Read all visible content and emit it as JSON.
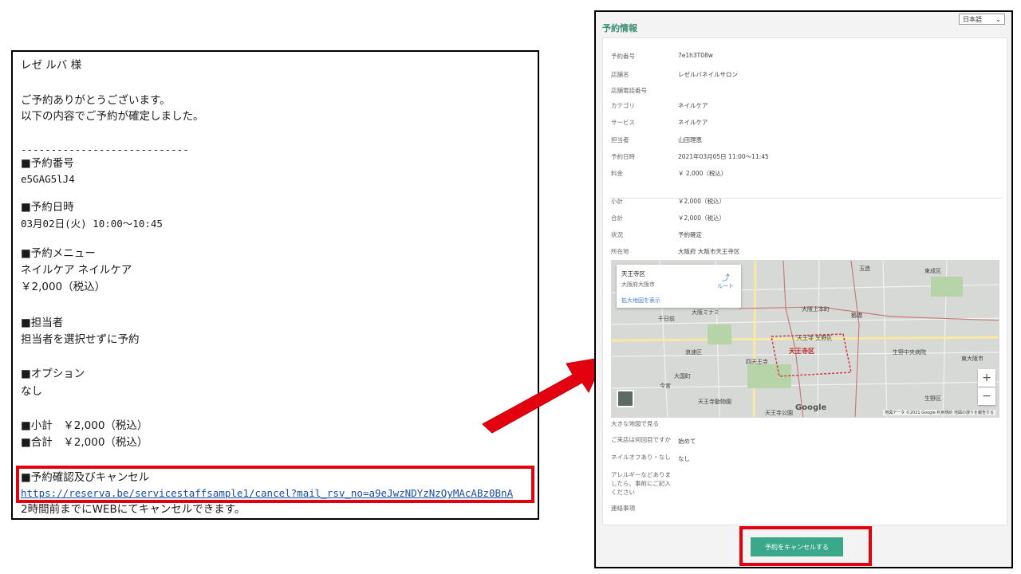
{
  "email": {
    "greeting": "レゼ ルバ 様",
    "thanks": "ご予約ありがとうございます。",
    "confirmed": "以下の内容でご予約が確定しました。",
    "separator": "----------------------------",
    "reservation_number_heading": "■予約番号",
    "reservation_number": "e5GAG5lJ4",
    "datetime_heading": "■予約日時",
    "datetime": "03月02日(火) 10:00〜10:45",
    "menu_heading": "■予約メニュー",
    "menu": "ネイルケア ネイルケア",
    "menu_price": "￥2,000（税込）",
    "staff_heading": "■担当者",
    "staff": "担当者を選択せずに予約",
    "option_heading": "■オプション",
    "option": "なし",
    "subtotal": "■小計　￥2,000（税込）",
    "total": "■合計　￥2,000（税込）",
    "cancel_heading": "■予約確認及びキャンセル",
    "cancel_link": "https://reserva.be/servicestaffsample1/cancel?mail_rsv_no=a9eJwzNDYzNzQyMAcABz0BnA",
    "cancel_note": "2時間前までにWEBにてキャンセルできます。"
  },
  "reservation": {
    "title": "予約情報",
    "language": "日本語",
    "rows": [
      {
        "label": "予約番号",
        "value": "7e1h3T08w"
      },
      {
        "label": "店舗名",
        "value": "レゼルバネイルサロン"
      },
      {
        "label": "店舗電話番号",
        "value": ""
      },
      {
        "label": "カテゴリ",
        "value": "ネイルケア"
      },
      {
        "label": "サービス",
        "value": "ネイルケア"
      },
      {
        "label": "担当者",
        "value": "山田理恵"
      },
      {
        "label": "予約日時",
        "value": "2021年03月05日 11:00〜11:45"
      },
      {
        "label": "料金",
        "value": "￥ 2,000（税込）"
      }
    ],
    "rows2": [
      {
        "label": "小計",
        "value": "￥2,000（税込）"
      },
      {
        "label": "合計",
        "value": "￥2,000（税込）"
      },
      {
        "label": "状況",
        "value": "予約確定"
      },
      {
        "label": "所在地",
        "value": "大阪府 大阪市天王寺区"
      }
    ],
    "map": {
      "place_name": "天王寺区",
      "place_sub": "大阪府大阪市",
      "route_label": "ルート",
      "larger_map_link": "拡大地図を表示",
      "district": "天王寺区",
      "labels": [
        "浪速区",
        "東成区",
        "生野区",
        "今宮",
        "大国町",
        "天王寺動物園",
        "天王寺公園",
        "大阪上本町",
        "天王寺 生野区",
        "生野中央病院",
        "千日前",
        "大阪ミナミ",
        "玉造",
        "鶴橋",
        "四天王寺",
        "東大阪市"
      ],
      "google": "Google",
      "footer": "地図データ ©2021 Google  利用規約  地図の誤りを報告する"
    },
    "larger_map": "大きな地図で見る",
    "extra_rows": [
      {
        "label": "ご来店は何回目ですか",
        "value": "始めて"
      },
      {
        "label": "ネイルオフあり・なし",
        "value": "なし"
      },
      {
        "label": "アレルギーなどありましたら、事前にご記入ください",
        "value": ""
      },
      {
        "label": "連絡事項",
        "value": ""
      }
    ],
    "cancel_button": "予約をキャンセルする"
  },
  "colors": {
    "highlight": "#e3000f",
    "accent_green": "#3aa98a",
    "title_green": "#3a8f76",
    "link_blue": "#1a4fa8"
  }
}
